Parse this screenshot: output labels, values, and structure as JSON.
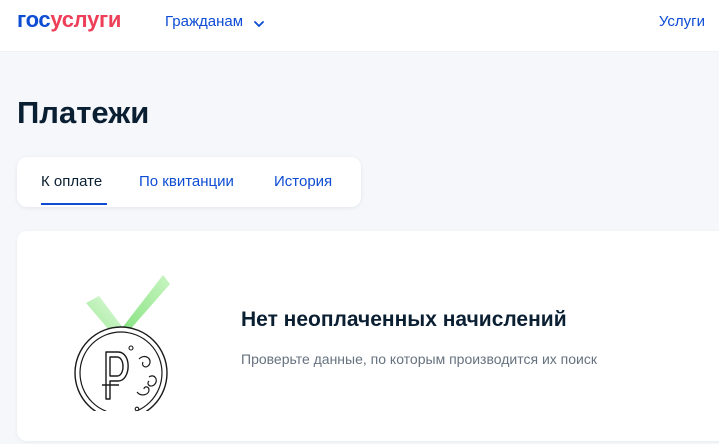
{
  "header": {
    "logo": {
      "part1": "гос",
      "part2": "услуги"
    },
    "nav_citizens": "Гражданам",
    "nav_services": "Услуги"
  },
  "page": {
    "title": "Платежи"
  },
  "tabs": [
    {
      "label": "К оплате",
      "active": true
    },
    {
      "label": "По квитанции",
      "active": false
    },
    {
      "label": "История",
      "active": false
    }
  ],
  "empty_state": {
    "title": "Нет неоплаченных начислений",
    "subtitle": "Проверьте данные, по которым производится их поиск",
    "icon": "ruble-medal-icon"
  },
  "colors": {
    "brand_blue": "#0d4cd3",
    "brand_red": "#ee3f58",
    "ribbon_green": "#7fe07a",
    "text_dark": "#0b1f33",
    "text_muted": "#66727f",
    "background": "#f5f7fa"
  }
}
